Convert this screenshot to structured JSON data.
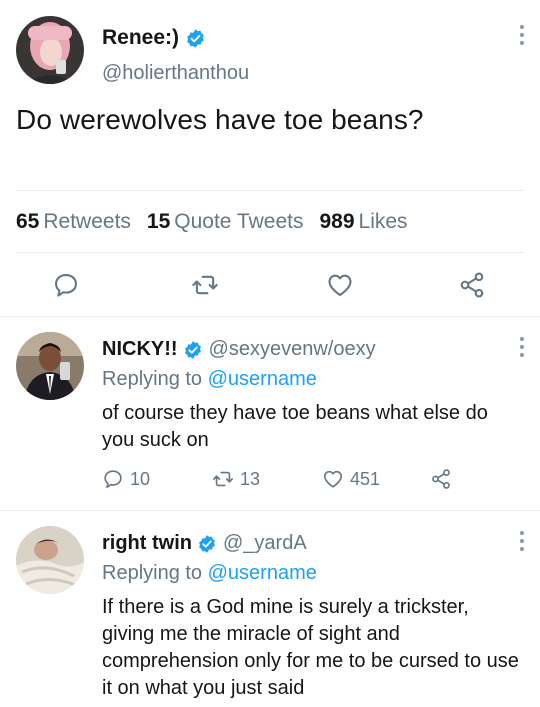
{
  "main": {
    "name": "Renee:)",
    "handle": "@holierthanthou",
    "text": "Do werewolves have toe beans?",
    "stats": {
      "retweets_count": "65",
      "retweets_label": "Retweets",
      "quotes_count": "15",
      "quotes_label": "Quote Tweets",
      "likes_count": "989",
      "likes_label": "Likes"
    },
    "actions": [
      "reply-icon",
      "retweet-icon",
      "like-icon",
      "share-icon"
    ]
  },
  "replies": [
    {
      "name": "NICKY!!",
      "handle": "@sexyevenw/oexy",
      "replying_prefix": "Replying to",
      "replying_to": "@username",
      "text": "of course they have toe beans what else do you suck on",
      "reply_count": "10",
      "retweet_count": "13",
      "like_count": "451"
    },
    {
      "name": "right twin",
      "handle": "@_yardA",
      "replying_prefix": "Replying to",
      "replying_to": "@username",
      "text": "If there is a God mine is surely a trickster, giving me the miracle of sight and comprehension only for me to be cursed to use it on what you just said"
    }
  ],
  "colors": {
    "accent": "#1da1f2",
    "secondary_text": "#657786",
    "divider": "#e6ecf0"
  }
}
